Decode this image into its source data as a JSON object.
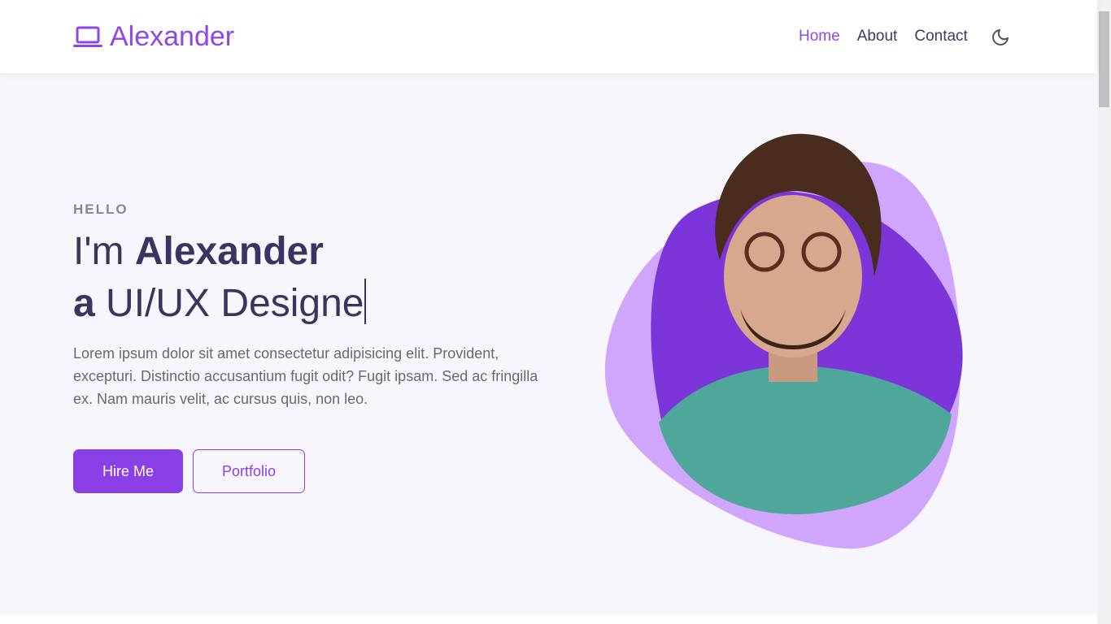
{
  "header": {
    "logo_text": "Alexander",
    "logo_icon": "laptop-icon",
    "nav": [
      {
        "label": "Home",
        "active": true
      },
      {
        "label": "About"
      },
      {
        "label": "Contact"
      }
    ],
    "theme_icon": "moon-icon"
  },
  "hero": {
    "eyebrow": "HELLO",
    "line1_prefix": "I'm ",
    "line1_name": "Alexander",
    "line2_prefix": "a",
    "line2_role": " UI/UX Designe",
    "description": "Lorem ipsum dolor sit amet consectetur adipisicing elit. Provident, excepturi. Distinctio accusantium fugit odit? Fugit ipsam. Sed ac fringilla ex. Nam mauris velit, ac cursus quis, non leo.",
    "hire_label": "Hire Me",
    "portfolio_label": "Portfolio"
  },
  "colors": {
    "accent": "#8b3fe6",
    "blob_light": "#cfa6fb",
    "blob_dark": "#7b35d8",
    "text": "#3a3560"
  }
}
